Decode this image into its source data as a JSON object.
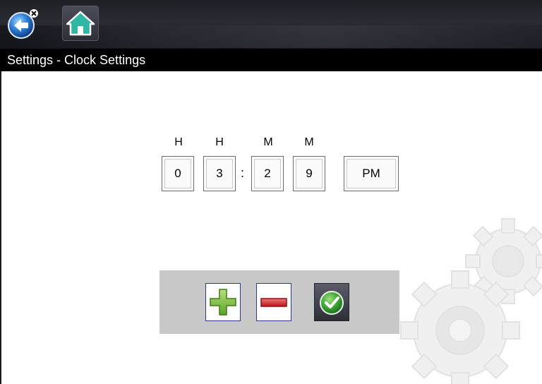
{
  "toolbar": {
    "back_icon": "back-arrow-icon",
    "home_icon": "home-icon"
  },
  "title": "Settings - Clock Settings",
  "clock": {
    "labels": [
      "H",
      "H",
      "M",
      "M"
    ],
    "digits": [
      "0",
      "3",
      "2",
      "9"
    ],
    "separator": ":",
    "meridiem": "PM"
  },
  "controls": {
    "increase_icon": "plus-icon",
    "decrease_icon": "minus-icon",
    "confirm_icon": "checkmark-icon"
  },
  "colors": {
    "plus": "#7cc242",
    "minus": "#d8232a",
    "check": "#3aa335",
    "panel": "#c8c8c8"
  }
}
